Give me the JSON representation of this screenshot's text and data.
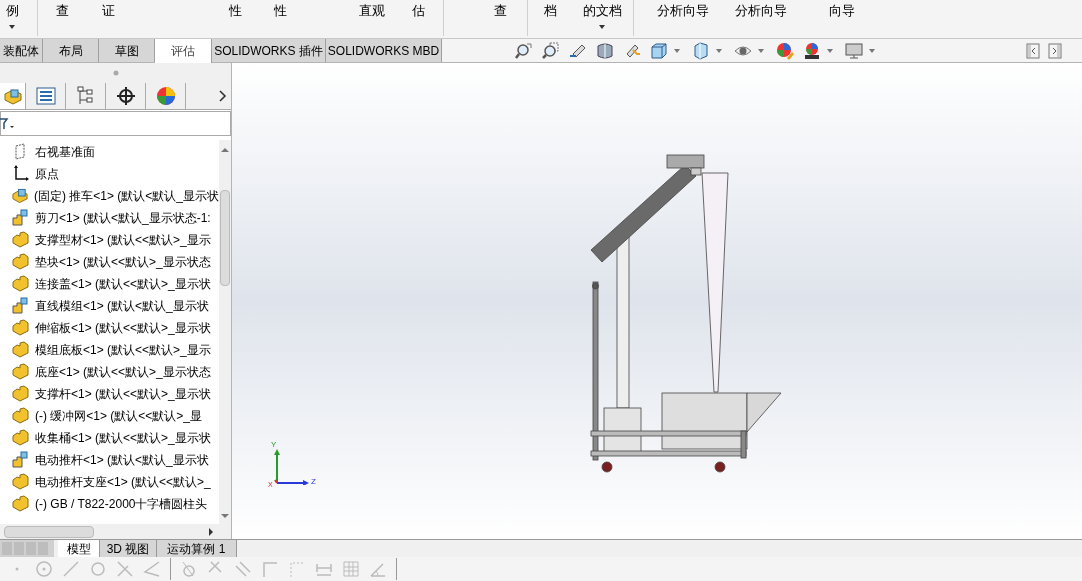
{
  "ribbon": [
    {
      "label": "例",
      "dropdown": true
    },
    {
      "label": "查",
      "dropdown": false
    },
    {
      "label": "证",
      "dropdown": false
    },
    {
      "label": "性",
      "dropdown": false
    },
    {
      "label": "性",
      "dropdown": false
    },
    {
      "label": "直观",
      "dropdown": false
    },
    {
      "label": "估",
      "dropdown": false
    },
    {
      "label": "查",
      "dropdown": false
    },
    {
      "label": "档",
      "dropdown": false
    },
    {
      "label": "的文档",
      "dropdown": true
    },
    {
      "label": "分析向导",
      "dropdown": false
    },
    {
      "label": "分析向导",
      "dropdown": false
    },
    {
      "label": "向导",
      "dropdown": false
    }
  ],
  "tabs": [
    {
      "label": "装配体",
      "selected": false
    },
    {
      "label": "布局",
      "selected": false
    },
    {
      "label": "草图",
      "selected": false
    },
    {
      "label": "评估",
      "selected": true
    },
    {
      "label": "SOLIDWORKS 插件",
      "selected": false
    },
    {
      "label": "SOLIDWORKS MBD",
      "selected": false
    }
  ],
  "tree": [
    {
      "kind": "plane",
      "label": "右视基准面"
    },
    {
      "kind": "origin",
      "label": "原点"
    },
    {
      "kind": "assembly",
      "label": "(固定) 推车<1> (默认<默认_显示状"
    },
    {
      "kind": "subassembly",
      "label": "剪刀<1> (默认<默认_显示状态-1:"
    },
    {
      "kind": "part",
      "label": "支撑型材<1> (默认<<默认>_显示"
    },
    {
      "kind": "part",
      "label": "垫块<1> (默认<<默认>_显示状态"
    },
    {
      "kind": "part",
      "label": "连接盖<1> (默认<<默认>_显示状"
    },
    {
      "kind": "subassembly",
      "label": "直线模组<1> (默认<默认_显示状"
    },
    {
      "kind": "part",
      "label": "伸缩板<1> (默认<<默认>_显示状"
    },
    {
      "kind": "part",
      "label": "模组底板<1> (默认<<默认>_显示"
    },
    {
      "kind": "part",
      "label": "底座<1> (默认<<默认>_显示状态"
    },
    {
      "kind": "part",
      "label": "支撑杆<1> (默认<<默认>_显示状"
    },
    {
      "kind": "part",
      "label": "(-) 缓冲网<1> (默认<<默认>_显"
    },
    {
      "kind": "part",
      "label": "收集桶<1> (默认<<默认>_显示状"
    },
    {
      "kind": "subassembly",
      "label": "电动推杆<1> (默认<默认_显示状"
    },
    {
      "kind": "part",
      "label": "电动推杆支座<1> (默认<<默认>_"
    },
    {
      "kind": "part",
      "label": "(-) GB / T822-2000十字槽圆柱头"
    }
  ],
  "bottom_tabs": [
    {
      "label": "模型",
      "selected": true
    },
    {
      "label": "3D 视图",
      "selected": false
    },
    {
      "label": "运动算例 1",
      "selected": false
    }
  ],
  "triad": {
    "y_label": "Y",
    "z_label": "Z",
    "x_label": "X"
  }
}
